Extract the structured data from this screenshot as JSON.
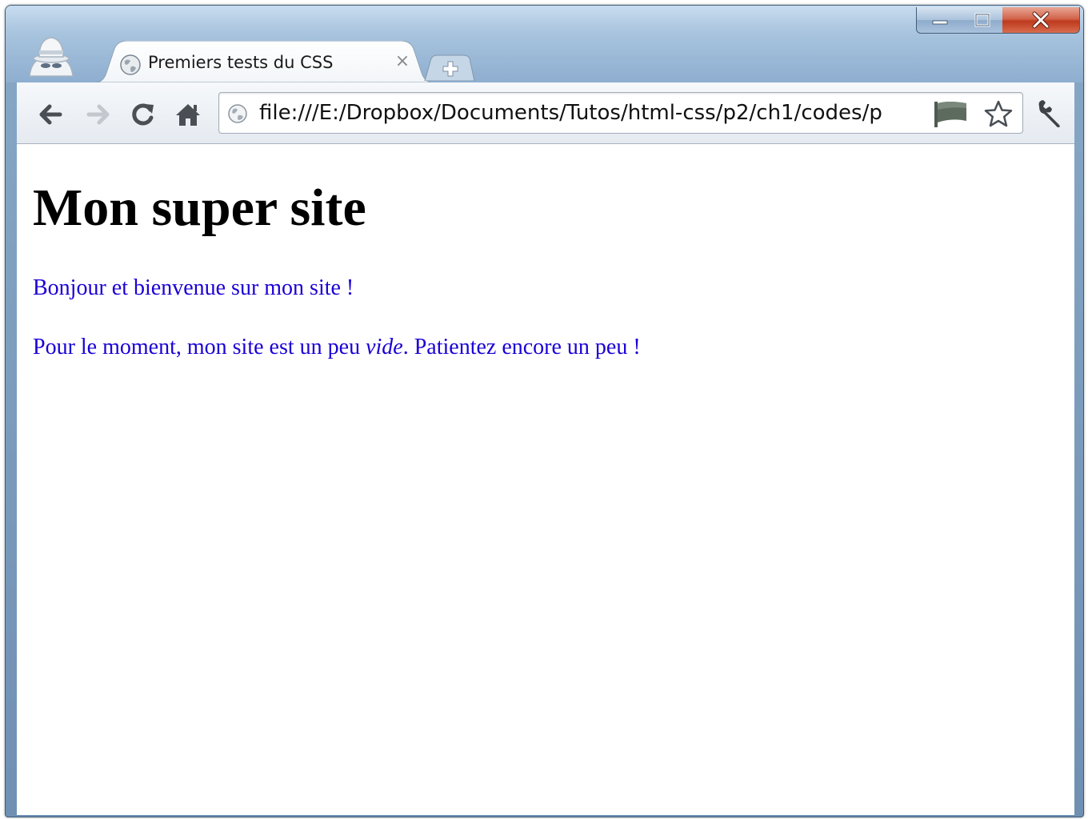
{
  "browser": {
    "tab": {
      "title": "Premiers tests du CSS",
      "close_glyph": "×"
    },
    "address_bar": {
      "url": "file:///E:/Dropbox/Documents/Tutos/html-css/p2/ch1/codes/p"
    },
    "icons": {
      "incognito": "incognito-icon",
      "favicon": "globe-icon",
      "back": "back-arrow-icon",
      "forward": "forward-arrow-icon",
      "reload": "reload-icon",
      "home": "home-icon",
      "page_info": "globe-icon",
      "page_action": "flag-icon",
      "bookmark": "star-icon",
      "menu": "wrench-icon"
    }
  },
  "page": {
    "heading": "Mon super site",
    "paragraph1": "Bonjour et bienvenue sur mon site !",
    "paragraph2": {
      "before": "Pour le moment, mon site est un peu ",
      "emphasis": "vide",
      "after": ". Patientez encore un peu !"
    }
  },
  "colors": {
    "paragraph_text": "#1a00d6",
    "heading_text": "#000000",
    "frame": "#7f9fc1",
    "close_button": "#c9462a"
  }
}
